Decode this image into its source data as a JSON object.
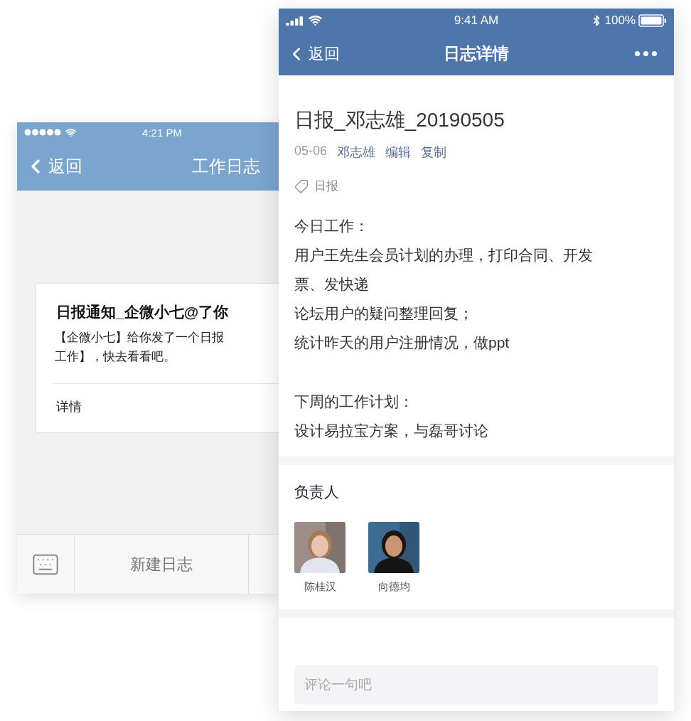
{
  "back_screen": {
    "status_bar": {
      "time": "4:21 PM"
    },
    "nav_bar": {
      "back": "返回",
      "title": "工作日志"
    },
    "card": {
      "title": "日报通知_企微小七@了你",
      "body_lines": [
        "【企微小七】给你发了一个日报",
        "工作】，快去看看吧。"
      ],
      "link": "详情"
    },
    "toolbar": {
      "button": "新建日志"
    }
  },
  "front_screen": {
    "status_bar": {
      "time": "9:41 AM",
      "battery": "100%"
    },
    "nav_bar": {
      "back": "返回",
      "title": "日志详情"
    },
    "report": {
      "title": "日报_邓志雄_20190505",
      "date": "05-06",
      "author": "邓志雄",
      "actions": [
        "编辑",
        "复制"
      ],
      "tag": "日报",
      "paragraphs": [
        [
          "今日工作：",
          "用户王先生会员计划的办理，打印合同、开发",
          "票、发快递",
          "论坛用户的疑问整理回复；",
          "统计昨天的用户注册情况，做ppt"
        ],
        [
          "下周的工作计划：",
          "设计易拉宝方案，与磊哥讨论"
        ]
      ]
    },
    "owners": {
      "heading": "负责人",
      "people": [
        {
          "name": "陈桂汉"
        },
        {
          "name": "向德均"
        }
      ]
    },
    "comment": {
      "placeholder": "评论一句吧"
    }
  }
}
